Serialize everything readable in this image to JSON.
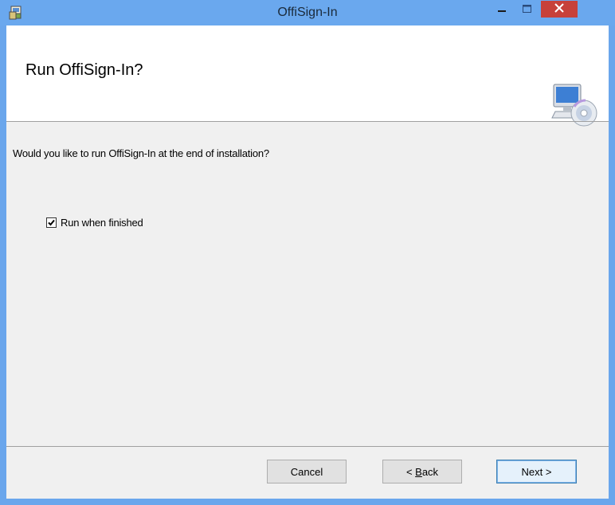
{
  "window": {
    "title": "OffiSign-In"
  },
  "banner": {
    "heading": "Run OffiSign-In?"
  },
  "body": {
    "question": "Would you like to run OffiSign-In at the end of installation?",
    "run_checkbox": {
      "label": "Run when finished",
      "checked": true
    }
  },
  "buttons": {
    "cancel": "Cancel",
    "back_prefix": "< ",
    "back_accel": "B",
    "back_rest": "ack",
    "next": "Next >"
  },
  "colors": {
    "titlebar": "#6aa8ee",
    "close": "#c7413a",
    "client": "#f0f0f0"
  },
  "icons": [
    "installer-icon",
    "minimize-icon",
    "maximize-icon",
    "close-icon",
    "computer-disc-icon",
    "checkmark-icon"
  ]
}
